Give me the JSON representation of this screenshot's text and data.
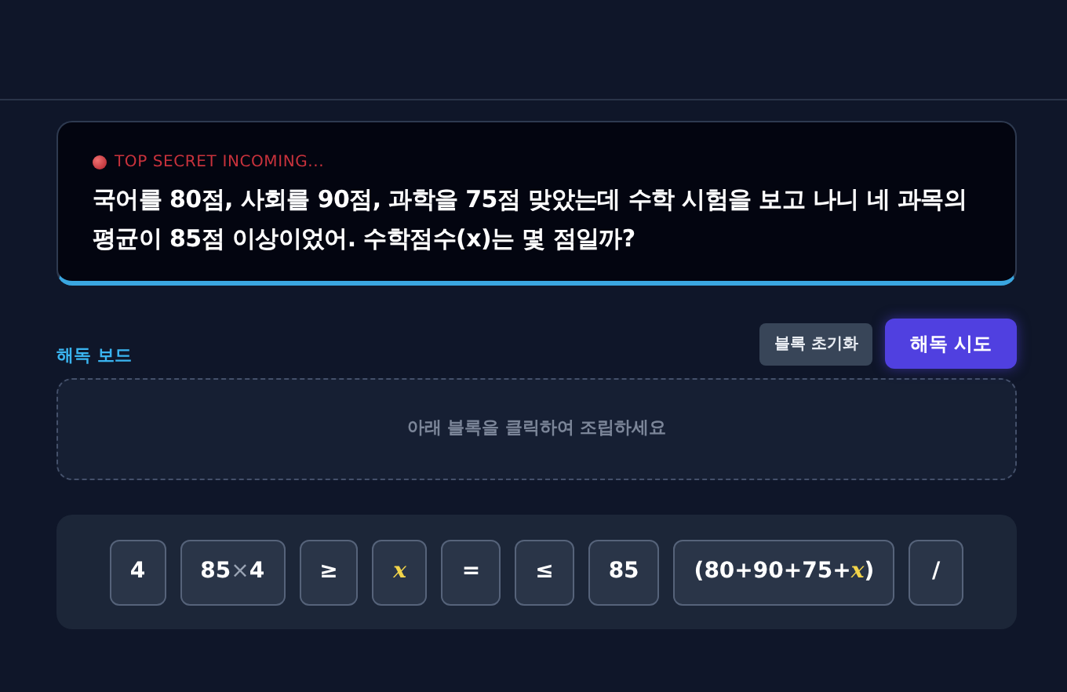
{
  "mission": {
    "tag": "TOP SECRET INCOMING...",
    "question": "국어를 80점, 사회를 90점, 과학을 75점 맞았는데 수학 시험을 보고 나니 네 과목의 평균이 85점 이상이었어. 수학점수(x)는 몇 점일까?"
  },
  "board": {
    "title": "해독 보드",
    "buttons": [
      {
        "label": "블록 초기화",
        "kind": "secondary"
      },
      {
        "label": "해독 시도",
        "kind": "primary"
      }
    ],
    "placeholder": "아래 블록을 클릭하여 조립하세요"
  },
  "blocks": [
    {
      "parts": [
        {
          "text": "4",
          "kind": "num"
        }
      ]
    },
    {
      "parts": [
        {
          "text": "85",
          "kind": "num"
        },
        {
          "text": "×",
          "kind": "times"
        },
        {
          "text": "4",
          "kind": "num"
        }
      ]
    },
    {
      "parts": [
        {
          "text": "≥",
          "kind": "num"
        }
      ]
    },
    {
      "parts": [
        {
          "text": "x",
          "kind": "var"
        }
      ]
    },
    {
      "parts": [
        {
          "text": "=",
          "kind": "num"
        }
      ]
    },
    {
      "parts": [
        {
          "text": "≤",
          "kind": "num"
        }
      ]
    },
    {
      "parts": [
        {
          "text": "85",
          "kind": "num"
        }
      ]
    },
    {
      "parts": [
        {
          "text": "(80+90+75+",
          "kind": "num"
        },
        {
          "text": "x",
          "kind": "var"
        },
        {
          "text": ")",
          "kind": "num"
        }
      ]
    },
    {
      "parts": [
        {
          "text": "/",
          "kind": "num"
        }
      ]
    }
  ]
}
